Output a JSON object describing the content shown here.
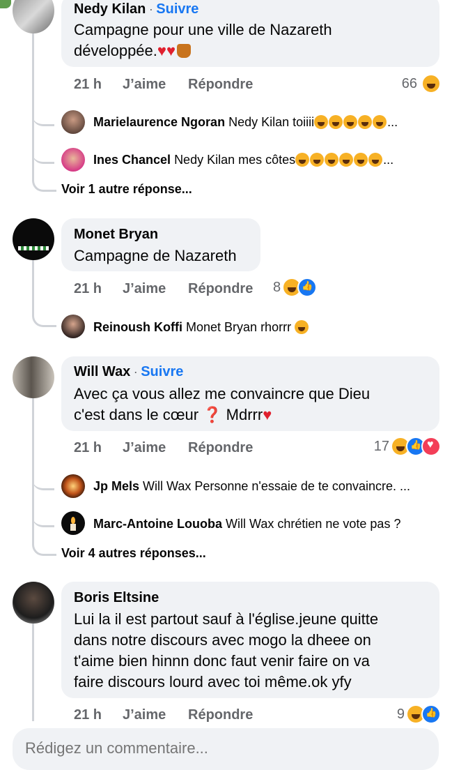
{
  "comments": [
    {
      "author": "Nedy Kilan",
      "follow": "Suivre",
      "text_lines": [
        "Campagne pour une ville de Nazareth",
        "développée."
      ],
      "time": "21 h",
      "like": "J’aime",
      "reply": "Répondre",
      "reaction_count": "66",
      "replies": [
        {
          "author": "Marielaurence Ngoran",
          "text": "Nedy Kilan toiiii"
        },
        {
          "author": "Ines Chancel",
          "text": "Nedy Kilan mes côtes"
        }
      ],
      "more": "Voir 1 autre réponse..."
    },
    {
      "author": "Monet Bryan",
      "text_lines": [
        "Campagne de Nazareth"
      ],
      "time": "21 h",
      "like": "J’aime",
      "reply": "Répondre",
      "reaction_count": "8",
      "replies": [
        {
          "author": "Reinoush Koffi",
          "text": "Monet Bryan rhorrr"
        }
      ]
    },
    {
      "author": "Will Wax",
      "follow": "Suivre",
      "text_lines": [
        "Avec ça vous allez me convaincre que Dieu",
        "c'est dans le cœur ❓ Mdrrr"
      ],
      "time": "21 h",
      "like": "J’aime",
      "reply": "Répondre",
      "reaction_count": "17",
      "replies": [
        {
          "author": "Jp Mels",
          "text": "Will Wax Personne n'essaie de te convaincre. ..."
        },
        {
          "author": "Marc-Antoine Louoba",
          "text": "Will Wax chrétien ne vote pas ?"
        }
      ],
      "more": "Voir 4 autres réponses..."
    },
    {
      "author": "Boris Eltsine",
      "text_lines": [
        "Lui la il est partout sauf à l'église.jeune quitte",
        "dans notre discours avec mogo la dheee on",
        "t'aime bien hinnn donc faut venir faire on va",
        "faire discours lourd avec toi même.ok yfy"
      ],
      "time": "21 h",
      "like": "J’aime",
      "reply": "Répondre",
      "reaction_count": "9"
    }
  ],
  "separator": "·",
  "ellipsis": "...",
  "composer": {
    "placeholder": "Rédigez un commentaire..."
  },
  "colors": {
    "link": "#1877f2",
    "bubble": "#f0f2f5",
    "meta": "#65676b",
    "haha": "#f7b125",
    "like": "#1877f2",
    "love": "#f33e58"
  }
}
